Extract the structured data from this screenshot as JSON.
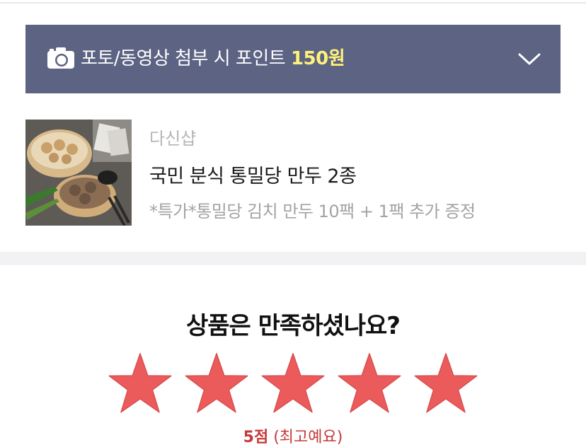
{
  "banner": {
    "text": "포토/동영상 첨부 시 포인트",
    "points": "150원",
    "icon": "camera-icon",
    "expand_icon": "chevron-down-icon",
    "bg_color": "#5c6383",
    "points_color": "#fff27a"
  },
  "product": {
    "seller": "다신샵",
    "name": "국민 분식 통밀당 만두 2종",
    "option": "*특가*통밀당 김치 만두 10팩 + 1팩 추가 증정"
  },
  "review": {
    "question": "상품은 만족하셨나요?",
    "rating": 5,
    "max_rating": 5,
    "score_label": "5점",
    "score_desc": "(최고예요)",
    "star_color": "#ec5b5b"
  }
}
